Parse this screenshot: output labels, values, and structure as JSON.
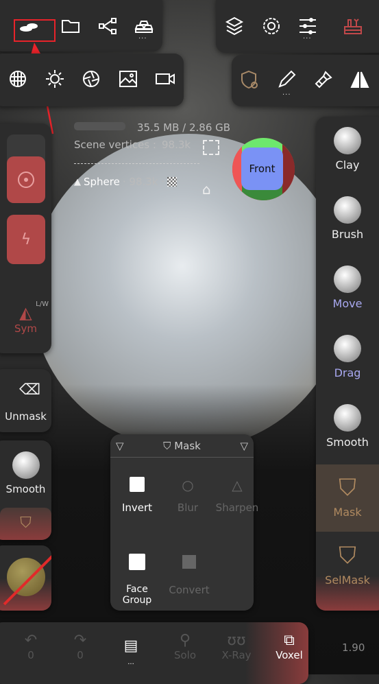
{
  "top_left": {
    "icons": [
      "scene-icon",
      "folder-icon",
      "share-icon",
      "gold-bars-icon"
    ],
    "more": "..."
  },
  "top_left_row2": {
    "icons": [
      "mesh-icon",
      "light-icon",
      "aperture-icon",
      "image-icon",
      "camera-icon"
    ]
  },
  "top_right": {
    "icons": [
      "layers-icon",
      "gear-icon",
      "sliders-icon",
      "toolbox-icon"
    ],
    "more": "...",
    "toolbox_color": "#c0484a"
  },
  "top_right_row2": {
    "icons": [
      "mask-settings-icon",
      "brush-icon",
      "paint-icon",
      "mirror-icon"
    ],
    "more": "..."
  },
  "info": {
    "memory": "35.5 MB / 2.86 GB",
    "vertices_label": "Scene vertices :",
    "vertices": "98.3k",
    "object": "Sphere",
    "object_vertices": "· 98.3k ·"
  },
  "gizmo": {
    "label": "Front"
  },
  "left": {
    "sym_label": "Sym",
    "sym_badge": "L/W",
    "unmask": "Unmask",
    "smooth": "Smooth"
  },
  "right_tools": [
    {
      "label": "Clay"
    },
    {
      "label": "Brush"
    },
    {
      "label": "Move"
    },
    {
      "label": "Drag"
    },
    {
      "label": "Smooth"
    },
    {
      "label": "Mask",
      "active": true
    },
    {
      "label": "SelMask"
    }
  ],
  "mask_popup": {
    "title": "Mask",
    "items": [
      {
        "label": "Invert",
        "enabled": true
      },
      {
        "label": "Blur",
        "enabled": false
      },
      {
        "label": "Sharpen",
        "enabled": false
      },
      {
        "label": "Face Group",
        "enabled": true
      },
      {
        "label": "Convert",
        "enabled": false
      }
    ]
  },
  "bottom": {
    "undo": "0",
    "redo": "0",
    "more": "...",
    "solo": "Solo",
    "xray": "X-Ray",
    "voxel": "Voxel",
    "value": "1.90"
  },
  "colors": {
    "accent_red": "#b24a4a",
    "mask_gold": "#b08a60",
    "move_blue": "#a8a8f0"
  }
}
